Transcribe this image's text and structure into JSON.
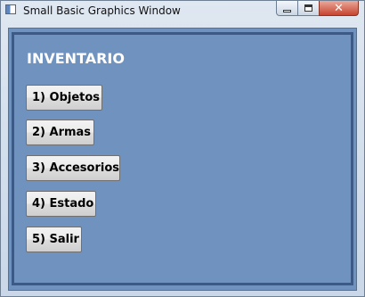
{
  "window": {
    "title": "Small Basic Graphics Window",
    "controls": {
      "minimize": "minimize-icon",
      "maximize": "maximize-icon",
      "close": "close-icon"
    }
  },
  "menu": {
    "heading": "INVENTARIO",
    "buttons": [
      {
        "label": "1) Objetos"
      },
      {
        "label": "2) Armas"
      },
      {
        "label": "3) Accesorios"
      },
      {
        "label": "4) Estado"
      },
      {
        "label": "5) Salir"
      }
    ]
  },
  "colors": {
    "background": "#6f92bf",
    "frame_border": "#3d5a87",
    "heading": "#ffffff"
  }
}
